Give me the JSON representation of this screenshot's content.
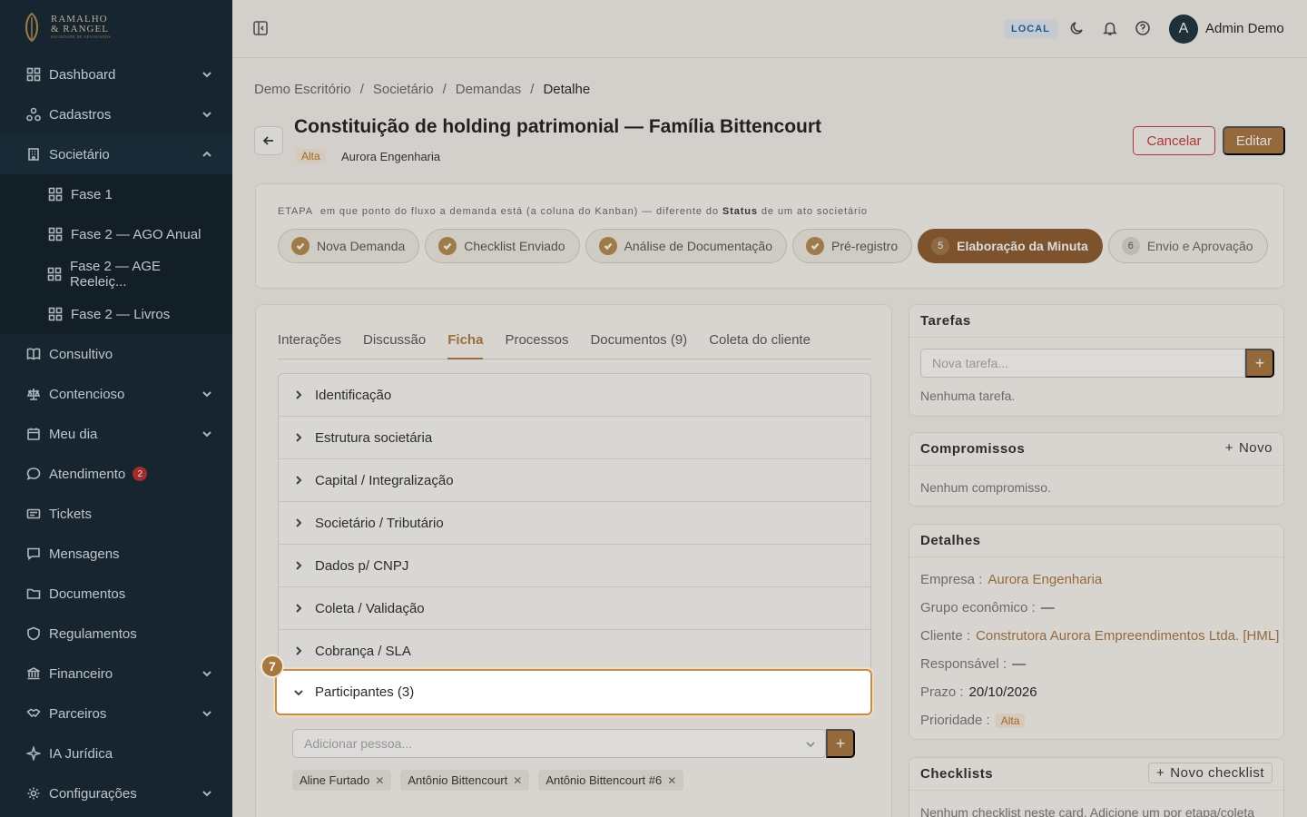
{
  "brand": {
    "line1": "RAMALHO",
    "line2": "& RANGEL",
    "tagline": "SOCIEDADE DE ADVOGADOS"
  },
  "sidebar": {
    "items": [
      {
        "label": "Dashboard",
        "icon": "grid-icon",
        "expandable": true
      },
      {
        "label": "Cadastros",
        "icon": "network-icon",
        "expandable": true
      },
      {
        "label": "Societário",
        "icon": "building-icon",
        "expandable": true,
        "open": true
      },
      {
        "label": "Consultivo",
        "icon": "book-icon"
      },
      {
        "label": "Contencioso",
        "icon": "scale-icon",
        "expandable": true
      },
      {
        "label": "Meu dia",
        "icon": "calendar-icon",
        "expandable": true
      },
      {
        "label": "Atendimento",
        "icon": "chat-icon",
        "badge": "2"
      },
      {
        "label": "Tickets",
        "icon": "ticket-icon"
      },
      {
        "label": "Mensagens",
        "icon": "message-icon"
      },
      {
        "label": "Documentos",
        "icon": "folder-icon"
      },
      {
        "label": "Regulamentos",
        "icon": "shield-icon"
      },
      {
        "label": "Financeiro",
        "icon": "bank-icon",
        "expandable": true
      },
      {
        "label": "Parceiros",
        "icon": "handshake-icon",
        "expandable": true
      },
      {
        "label": "IA Jurídica",
        "icon": "sparkle-icon"
      },
      {
        "label": "Configurações",
        "icon": "gear-icon",
        "expandable": true
      }
    ],
    "sub_items": [
      "Fase 1",
      "Fase 2 — AGO Anual",
      "Fase 2 — AGE Reeleiç...",
      "Fase 2 — Livros"
    ]
  },
  "topbar": {
    "env": "LOCAL",
    "avatar_initial": "A",
    "user": "Admin Demo"
  },
  "breadcrumb": [
    "Demo Escritório",
    "Societário",
    "Demandas",
    "Detalhe"
  ],
  "header": {
    "title": "Constituição de holding patrimonial — Família Bittencourt",
    "priority": "Alta",
    "company": "Aurora Engenharia",
    "cancel": "Cancelar",
    "edit": "Editar"
  },
  "stage": {
    "caption_prefix": "ETAPA",
    "caption_mid": "em que ponto do fluxo a demanda está (a coluna do Kanban) — diferente do",
    "caption_bold": "Status",
    "caption_suffix": "de um ato societário",
    "steps": [
      {
        "label": "Nova Demanda",
        "state": "done"
      },
      {
        "label": "Checklist Enviado",
        "state": "done"
      },
      {
        "label": "Análise de Documentação",
        "state": "done"
      },
      {
        "label": "Pré-registro",
        "state": "done"
      },
      {
        "label": "Elaboração da Minuta",
        "state": "active",
        "num": "5"
      },
      {
        "label": "Envio e Aprovação",
        "state": "future",
        "num": "6"
      }
    ]
  },
  "tabs": [
    "Interações",
    "Discussão",
    "Ficha",
    "Processos",
    "Documentos (9)",
    "Coleta do cliente"
  ],
  "active_tab": "Ficha",
  "sections": [
    "Identificação",
    "Estrutura societária",
    "Capital / Integralização",
    "Societário / Tributário",
    "Dados p/ CNPJ",
    "Coleta / Validação",
    "Cobrança / SLA"
  ],
  "participants": {
    "header": "Participantes (3)",
    "placeholder": "Adicionar pessoa...",
    "people": [
      "Aline Furtado",
      "Antônio Bittencourt",
      "Antônio Bittencourt #6"
    ]
  },
  "tour": {
    "step": "7"
  },
  "tarefas": {
    "title": "Tarefas",
    "placeholder": "Nova tarefa...",
    "empty": "Nenhuma tarefa."
  },
  "compromissos": {
    "title": "Compromissos",
    "action": "Novo",
    "empty": "Nenhum compromisso."
  },
  "detalhes": {
    "title": "Detalhes",
    "rows": [
      {
        "k": "Empresa :",
        "v": "Aurora Engenharia"
      },
      {
        "k": "Grupo econômico :",
        "v": "—"
      },
      {
        "k": "Cliente :",
        "v": "Construtora Aurora Empreendimentos Ltda. [HML]"
      },
      {
        "k": "Responsável :",
        "v": "—"
      },
      {
        "k": "Prazo :",
        "v": "20/10/2026"
      },
      {
        "k": "Prioridade :",
        "v": "Alta"
      }
    ]
  },
  "checklists": {
    "title": "Checklists",
    "action": "Novo checklist",
    "empty": "Nenhum checklist neste card. Adicione um por etapa/coleta"
  }
}
